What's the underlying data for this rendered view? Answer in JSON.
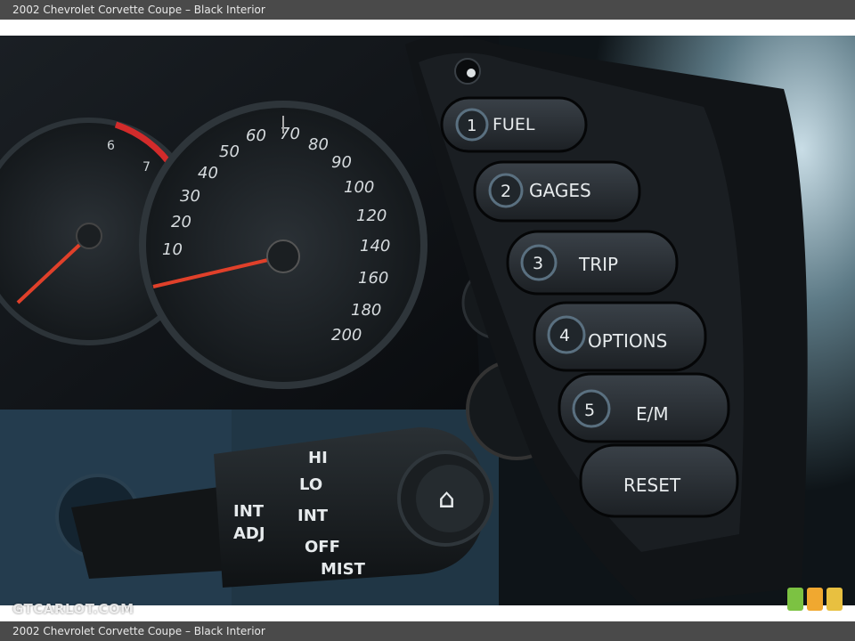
{
  "caption": "2002 Chevrolet Corvette Coupe – Black Interior",
  "photo": {
    "buttons": [
      {
        "number": "1",
        "label": "FUEL"
      },
      {
        "number": "2",
        "label": "GAGES"
      },
      {
        "number": "3",
        "label": "TRIP"
      },
      {
        "number": "4",
        "label": "OPTIONS"
      },
      {
        "number": "5",
        "label": "E/M"
      },
      {
        "label": "RESET"
      }
    ],
    "speedometer_ticks": [
      "30",
      "40",
      "50",
      "60",
      "70",
      "80",
      "90",
      "100",
      "120",
      "140",
      "160",
      "180",
      "200",
      "10",
      "20"
    ],
    "tachometer_ticks": [
      "6",
      "7"
    ],
    "stalk_labels": [
      "HI",
      "LO",
      "INT",
      "OFF",
      "MIST",
      "INT",
      "ADJ"
    ]
  },
  "watermark": "GTCARLOT.COM",
  "logo_colors": [
    "#7cc242",
    "#f0a830",
    "#e8c040"
  ]
}
